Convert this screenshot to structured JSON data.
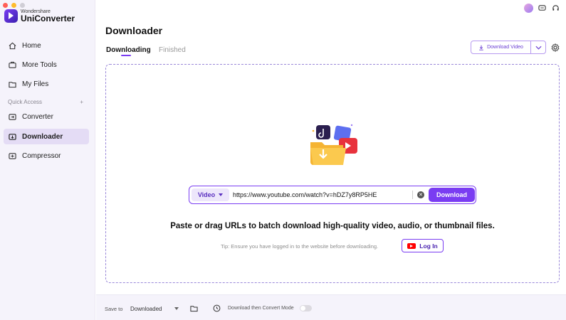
{
  "app": {
    "brand_small": "Wondershare",
    "brand_name": "UniConverter"
  },
  "sidebar": {
    "items": [
      {
        "label": "Home",
        "icon": "home-icon"
      },
      {
        "label": "More Tools",
        "icon": "tools-icon"
      },
      {
        "label": "My Files",
        "icon": "files-icon"
      }
    ],
    "quick_access_label": "Quick Access",
    "quick_access_add": "+",
    "quick_items": [
      {
        "label": "Converter",
        "icon": "converter-icon",
        "active": false
      },
      {
        "label": "Downloader",
        "icon": "downloader-icon",
        "active": true
      },
      {
        "label": "Compressor",
        "icon": "compressor-icon",
        "active": false
      }
    ]
  },
  "header": {
    "title": "Downloader",
    "tabs": [
      {
        "label": "Downloading",
        "active": true
      },
      {
        "label": "Finished",
        "active": false
      }
    ],
    "download_video_label": "Download Video"
  },
  "main": {
    "type_select": "Video",
    "url_value": "https://www.youtube.com/watch?v=hDZ7y8RP5HE",
    "download_label": "Download",
    "instruction": "Paste or drag URLs to batch download high-quality video, audio, or thumbnail files.",
    "tip": "Tip: Ensure you have logged in to the website before downloading.",
    "login_label": "Log In"
  },
  "footer": {
    "save_to_label": "Save to",
    "save_to_value": "Downloaded",
    "convert_mode_label": "Download then Convert Mode",
    "convert_mode_on": false
  },
  "colors": {
    "accent": "#7a3cf2",
    "sidebar_bg": "#f5f3fb",
    "active_item_bg": "#e4dcf5"
  }
}
